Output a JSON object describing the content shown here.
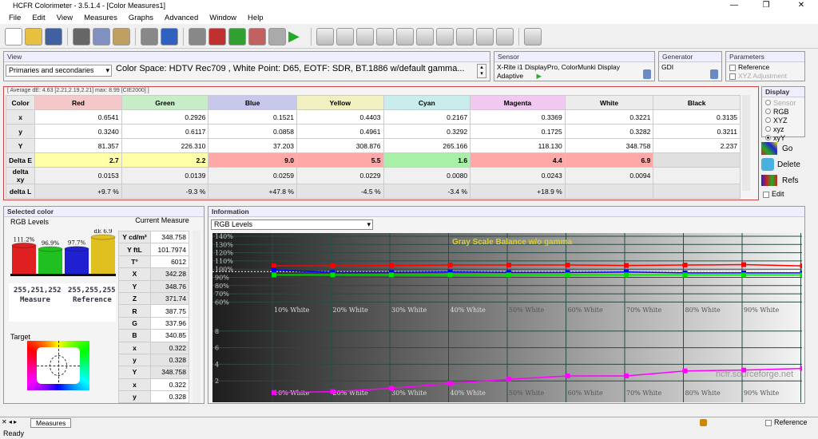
{
  "window": {
    "title": "HCFR Colorimeter - 3.5.1.4 - [Color Measures1]",
    "min": "—",
    "max": "❐",
    "close": "✕"
  },
  "menu": [
    "File",
    "Edit",
    "View",
    "Measures",
    "Graphs",
    "Advanced",
    "Window",
    "Help"
  ],
  "toolbar_icons": [
    "new-icon",
    "open-icon",
    "save-icon",
    "cut-icon",
    "copy-icon",
    "paste-icon",
    "print-icon",
    "help-icon",
    "sensor-icon",
    "color-balls-icon",
    "rgb-icon",
    "palette-icon",
    "camera-icon",
    "play-icon",
    "monitor-icon",
    "graph-gamma-icon",
    "graph-luminance-icon",
    "graph-rgb-icon",
    "graph-cie-icon",
    "graph-colortemp-icon",
    "graph-sat-icon",
    "graph-near-black-icon",
    "graph-near-white-icon",
    "graph-levels-icon",
    "graph-measures-icon"
  ],
  "view": {
    "title": "View",
    "mode": "Primaries and secondaries",
    "info": "Color Space: HDTV Rec709 , White Point: D65, EOTF:  SDR, BT.1886 w/default gamma..."
  },
  "sensor": {
    "title": "Sensor",
    "name": "X-Rite i1 DisplayPro, ColorMunki Display",
    "mode": "Adaptive"
  },
  "generator": {
    "title": "Generator",
    "name": "GDI"
  },
  "parameters": {
    "title": "Parameters",
    "reference": "Reference",
    "xyz_adjust": "XYZ Adjustment"
  },
  "summary": "[ Average dE: 4.63 [2.21,2.19,2.21] max: 8.99 [CIE2000] ]",
  "table": {
    "headers": [
      "Color",
      "Red",
      "Green",
      "Blue",
      "Yellow",
      "Cyan",
      "Magenta",
      "White",
      "Black"
    ],
    "header_colors": [
      "#e8e8e8",
      "#f4c8c8",
      "#c8ecc8",
      "#c8c8ec",
      "#f0f0c0",
      "#c8ecec",
      "#f0c8f0",
      "#ececec",
      "#ececec"
    ],
    "rows": [
      {
        "label": "x",
        "values": [
          "0.6541",
          "0.2926",
          "0.1521",
          "0.4403",
          "0.2167",
          "0.3369",
          "0.3221",
          "0.3135"
        ]
      },
      {
        "label": "y",
        "values": [
          "0.3240",
          "0.6117",
          "0.0858",
          "0.4961",
          "0.3292",
          "0.1725",
          "0.3282",
          "0.3211"
        ]
      },
      {
        "label": "Y",
        "values": [
          "81.357",
          "226.310",
          "37.203",
          "308.876",
          "265.166",
          "118.130",
          "348.758",
          "2.237"
        ]
      },
      {
        "label": "Delta E",
        "values": [
          "2.7",
          "2.2",
          "9.0",
          "5.5",
          "1.6",
          "4.4",
          "6.9",
          ""
        ],
        "colors": [
          "#ffffa8",
          "#ffffa8",
          "#ffa8a8",
          "#ffa8a8",
          "#a8f0a8",
          "#ffa8a8",
          "#ffa8a8",
          "#e0e0e0"
        ]
      },
      {
        "label": "delta xy",
        "values": [
          "0.0153",
          "0.0139",
          "0.0259",
          "0.0229",
          "0.0080",
          "0.0243",
          "0.0094",
          ""
        ]
      },
      {
        "label": "delta L",
        "values": [
          "+9.7 %",
          "-9.3 %",
          "+47.8 %",
          "-4.5 %",
          "-3.4 %",
          "+18.9 %",
          "",
          ""
        ]
      }
    ]
  },
  "display": {
    "title": "Display",
    "options": [
      "Sensor",
      "RGB",
      "XYZ",
      "xyz",
      "xyY"
    ],
    "selected": "xyY",
    "go": "Go",
    "delete": "Delete",
    "refs": "Refs",
    "edit": "Edit"
  },
  "selected_color": {
    "title": "Selected color",
    "rgb_levels": "RGB Levels",
    "bars": [
      {
        "label": "111.2%",
        "value": 111.2,
        "color": "#e02020"
      },
      {
        "label": "96.9%",
        "value": 96.9,
        "color": "#20c020"
      },
      {
        "label": "97.7%",
        "value": 97.7,
        "color": "#2020d0"
      },
      {
        "label": "dE 6.9",
        "value": 6.9,
        "color": "#e0c020"
      }
    ],
    "measure_rgb": "255,251,252",
    "measure": "Measure",
    "reference_rgb": "255,255,255",
    "reference": "Reference",
    "target": "Target"
  },
  "current_measure": {
    "title": "Current Measure",
    "rows": [
      [
        "Y cd/m²",
        "348.758"
      ],
      [
        "Y ftL",
        "101.7974"
      ],
      [
        "T°",
        "6012"
      ],
      [
        "X",
        "342.28"
      ],
      [
        "Y",
        "348.76"
      ],
      [
        "Z",
        "371.74"
      ],
      [
        "R",
        "387.75"
      ],
      [
        "G",
        "337.96"
      ],
      [
        "B",
        "340.85"
      ],
      [
        "x",
        "0.322"
      ],
      [
        "y",
        "0.328"
      ],
      [
        "Y",
        "348.758"
      ],
      [
        "x",
        "0.322"
      ],
      [
        "y",
        "0.328"
      ]
    ]
  },
  "information": {
    "title": "Information",
    "graph_select": "RGB Levels",
    "watermark": "hcfr.sourceforge.net"
  },
  "chart_data": [
    {
      "type": "line",
      "title": "Gray Scale Balance w/o gamma",
      "categories": [
        "10% White",
        "20% White",
        "30% White",
        "40% White",
        "50% White",
        "60% White",
        "70% White",
        "80% White",
        "90% White",
        "100% White"
      ],
      "y_ticks": [
        "140%",
        "130%",
        "120%",
        "110%",
        "100%",
        "90%",
        "80%",
        "70%",
        "60%"
      ],
      "ylim": [
        60,
        140
      ],
      "reference": 100,
      "grid": true,
      "series": [
        {
          "color": "#ff0000",
          "values": [
            104,
            104,
            104.5,
            105,
            105,
            105,
            104.5,
            105,
            105.5,
            104
          ]
        },
        {
          "color": "#0000ff",
          "values": [
            99,
            96,
            96,
            96.5,
            96,
            96,
            96.5,
            95.5,
            95.5,
            95.5
          ]
        },
        {
          "color": "#00e000",
          "values": [
            93,
            93,
            93,
            93,
            93,
            93,
            93,
            93,
            93,
            93
          ]
        }
      ]
    },
    {
      "type": "line",
      "categories": [
        "10% White",
        "20% White",
        "30% White",
        "40% White",
        "50% White",
        "60% White",
        "70% White",
        "80% White",
        "90% White",
        "100% White"
      ],
      "y_ticks": [
        "8",
        "6",
        "4",
        "2"
      ],
      "ylim": [
        0,
        10
      ],
      "grid": true,
      "series": [
        {
          "color": "#ff00ff",
          "values": [
            0.6,
            0.7,
            1.1,
            1.7,
            2.2,
            2.6,
            2.6,
            3.2,
            3.3,
            3.5
          ]
        }
      ]
    }
  ],
  "tabs": {
    "active": "Measures"
  },
  "status": {
    "text": "Ready",
    "reference": "Reference"
  }
}
